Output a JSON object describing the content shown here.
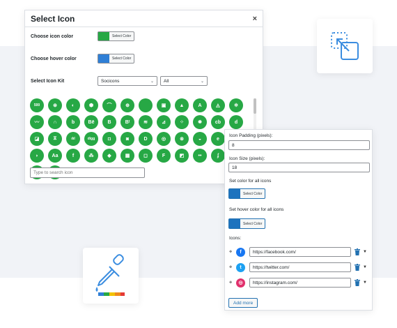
{
  "dialog": {
    "title": "Select Icon",
    "close": "×",
    "icon_color_label": "Choose icon color",
    "hover_color_label": "Choose hover color",
    "icon_kit_label": "Select Icon Kit",
    "select_color_text": "Select Color",
    "icon_color": "#27a845",
    "hover_color": "#2f7fd6",
    "kit_select": "Socicons",
    "filter_select": "All",
    "search_placeholder": "Type to search icon",
    "icon_glyphs": [
      "500",
      "⊛",
      "◐",
      "⬢",
      "⌒",
      "⊕",
      "",
      "▣",
      "▲",
      "A",
      "◬",
      "✲",
      "〰",
      "∩",
      "b",
      "Bē",
      "B",
      "Bᵗ",
      "≋",
      "⊿",
      "⁘",
      "✹",
      "cb",
      "d",
      "◪",
      "⧖",
      "ılıl",
      "digg",
      "◘",
      "◙",
      "D",
      "◎",
      "⊗",
      "◒",
      "e",
      "ⓔ",
      "◗",
      "Aa",
      "f",
      "⁂",
      "◆",
      "▦",
      "◻",
      "F",
      "◩",
      "••",
      "ʄ",
      "ff",
      "◉",
      "g"
    ]
  },
  "panel": {
    "padding_label": "Icon Padding (pixels):",
    "padding_value": "8",
    "size_label": "Icon Size (pixels):",
    "size_value": "18",
    "set_color_label": "Set color for all icons",
    "set_hover_label": "Set hover color for all icons",
    "select_color_text": "Select Color",
    "icons_label": "Icons:",
    "icons": [
      {
        "name": "facebook",
        "glyph": "f",
        "color": "#1877f2",
        "url": "https://facebook.com/"
      },
      {
        "name": "twitter",
        "glyph": "t",
        "color": "#1da1f2",
        "url": "https://twitter.com/"
      },
      {
        "name": "instagram",
        "glyph": "◎",
        "color": "#e1306c",
        "url": "https://instagram.com/"
      }
    ],
    "add_more": "Add more"
  }
}
